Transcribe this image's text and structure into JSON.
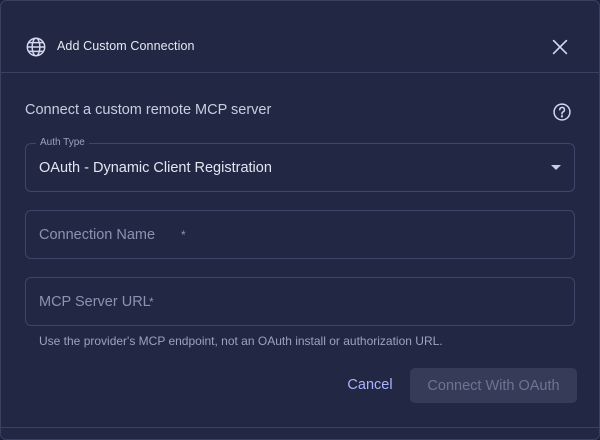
{
  "dialog": {
    "title": "Add Custom Connection",
    "icon": "globe-icon",
    "close_icon": "close-icon"
  },
  "intro_text": "Connect a custom remote MCP server",
  "help_icon": "help-circle-icon",
  "auth_type": {
    "label": "Auth Type",
    "value": "OAuth - Dynamic Client Registration"
  },
  "connection_name": {
    "placeholder": "Connection Name",
    "required_mark": "*",
    "value": ""
  },
  "server_url": {
    "placeholder": "MCP Server URL",
    "required_mark": "*",
    "value": "",
    "hint": "Use the provider's MCP endpoint, not an OAuth install or authorization URL."
  },
  "actions": {
    "cancel_label": "Cancel",
    "connect_label": "Connect With OAuth",
    "connect_disabled": true
  },
  "colors": {
    "background": "#222843",
    "accent": "#a9b4ff",
    "border": "#3f4668"
  }
}
